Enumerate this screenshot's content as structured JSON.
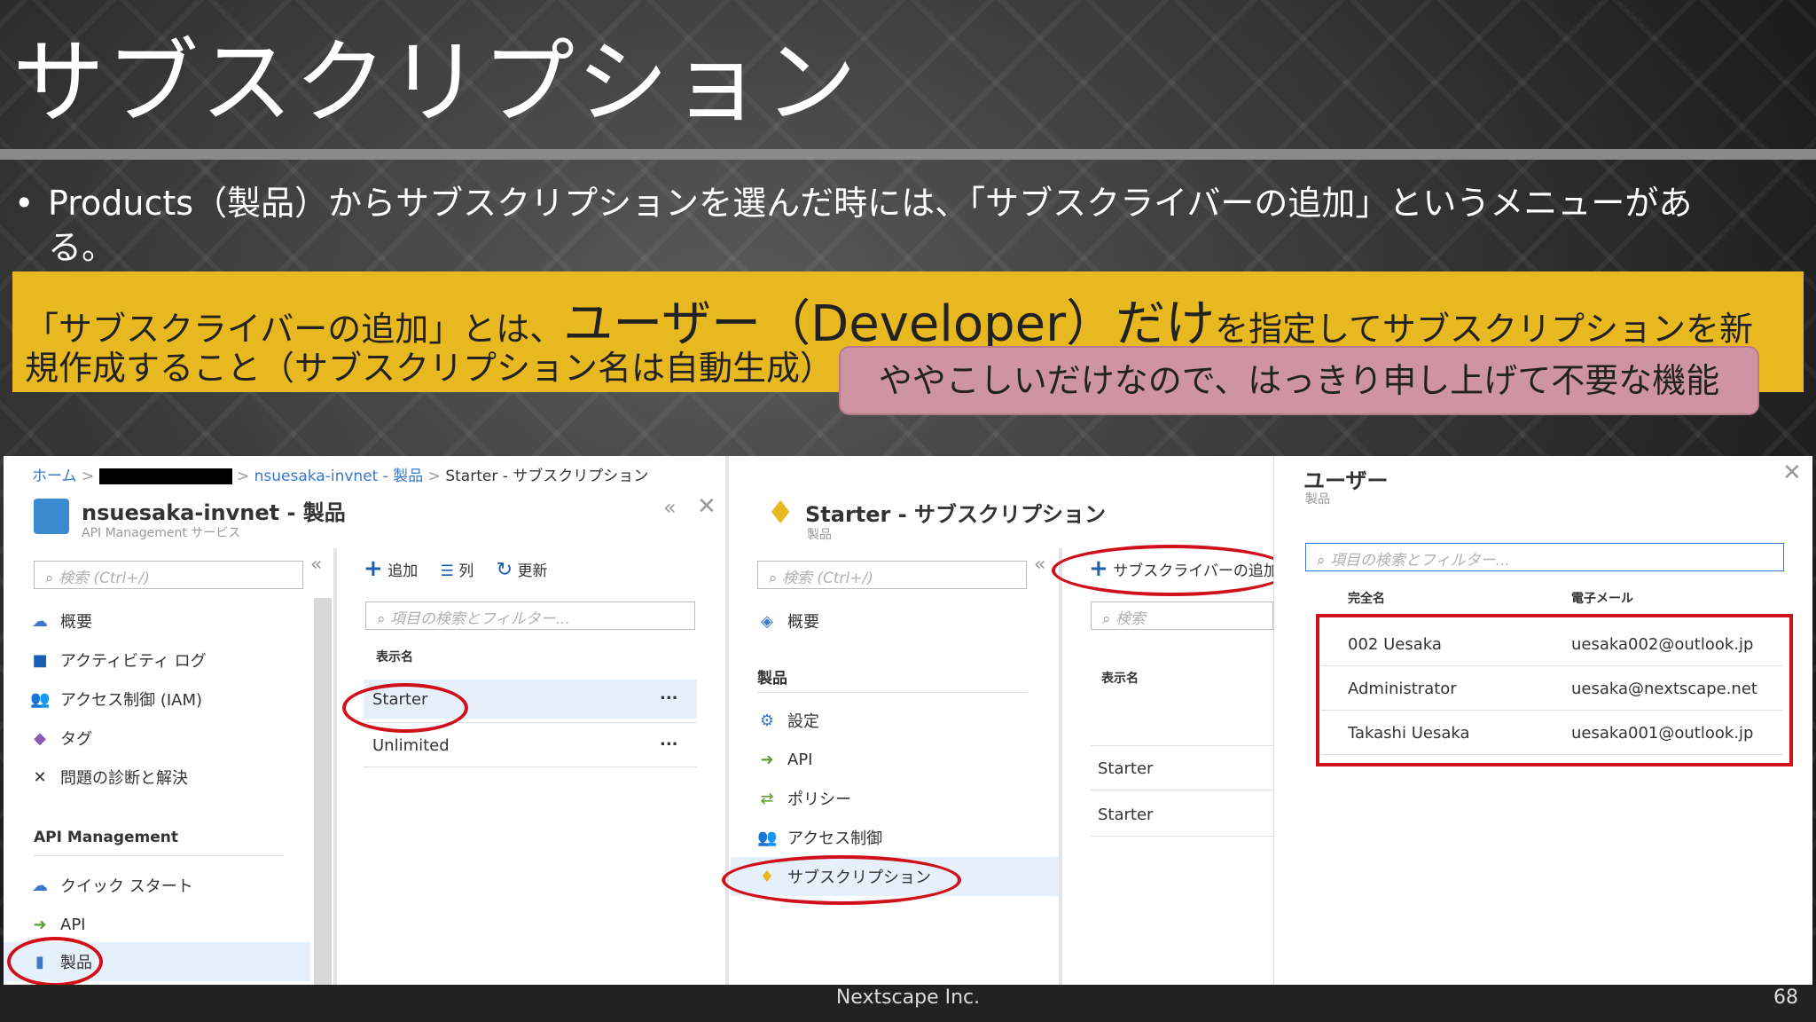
{
  "slide": {
    "title": "サブスクリプション",
    "bullet": "Products（製品）からサブスクリプションを選んだ時には、「サブスクライバーの追加」というメニューがある。",
    "callout_line1_pre": "「サブスクライバーの追加」とは、",
    "callout_line1_big": "ユーザー（Developer）だけ",
    "callout_line1_post": "を指定してサブスクリプションを新",
    "callout_line2": "規作成すること（サブスクリプション名は自動生成）",
    "note": "ややこしいだけなので、はっきり申し上げて不要な機能",
    "footer_company": "Nextscape Inc.",
    "page_number": "68"
  },
  "breadcrumb": {
    "home": "ホーム",
    "product": "nsuesaka-invnet - 製品",
    "current": "Starter - サブスクリプション"
  },
  "blade1": {
    "title": "nsuesaka-invnet - 製品",
    "subtitle": "API Management サービス",
    "search_placeholder": "検索 (Ctrl+/)",
    "nav": [
      "概要",
      "アクティビティ ログ",
      "アクセス制御 (IAM)",
      "タグ",
      "問題の診断と解決"
    ],
    "section": "API Management",
    "nav2": [
      "クイック スタート",
      "API",
      "製品"
    ]
  },
  "blade1_list": {
    "add": "追加",
    "columns": "列",
    "refresh": "更新",
    "filter_placeholder": "項目の検索とフィルター...",
    "header": "表示名",
    "rows": [
      "Starter",
      "Unlimited"
    ],
    "more": "..."
  },
  "blade2": {
    "title": "Starter - サブスクリプション",
    "subtitle": "製品",
    "search_placeholder": "検索 (Ctrl+/)",
    "overview": "概要",
    "section": "製品",
    "nav": [
      "設定",
      "API",
      "ポリシー",
      "アクセス制御",
      "サブスクリプション"
    ]
  },
  "blade2_list": {
    "add_subscriber": "サブスクライバーの追加",
    "search_placeholder": "検索",
    "header": "表示名",
    "rows": [
      "Starter",
      "Starter"
    ]
  },
  "users": {
    "title": "ユーザー",
    "subtitle": "製品",
    "filter_placeholder": "項目の検索とフィルター...",
    "col_name": "完全名",
    "col_email": "電子メール",
    "rows": [
      {
        "name": "002 Uesaka",
        "email": "uesaka002@outlook.jp"
      },
      {
        "name": "Administrator",
        "email": "uesaka@nextscape.net"
      },
      {
        "name": "Takashi Uesaka",
        "email": "uesaka001@outlook.jp"
      }
    ]
  },
  "colors": {
    "accent": "#3a78c9",
    "highlight_red": "#d0101a",
    "callout_yellow": "#e8b820",
    "note_pink": "#cf94a3"
  }
}
